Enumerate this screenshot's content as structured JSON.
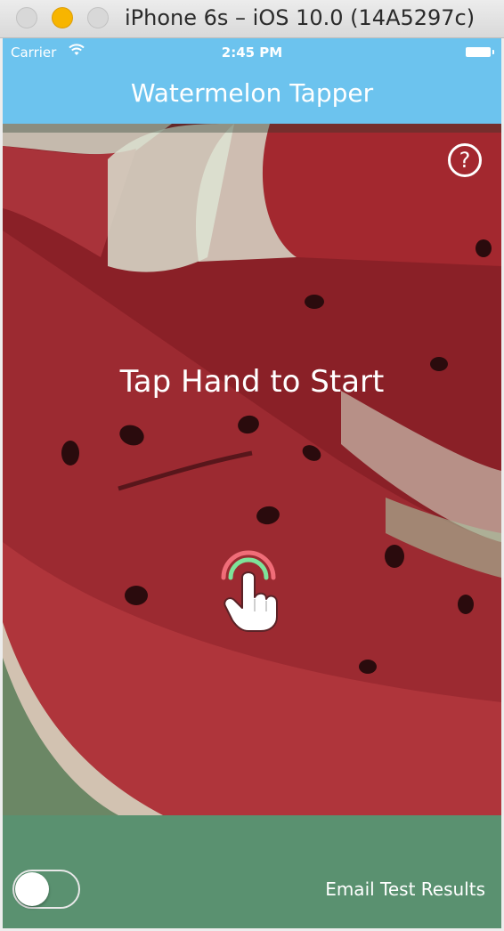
{
  "window": {
    "title": "iPhone 6s – iOS 10.0 (14A5297c)"
  },
  "status_bar": {
    "carrier": "Carrier",
    "time": "2:45 PM"
  },
  "nav": {
    "title": "Watermelon Tapper"
  },
  "main": {
    "help_label": "?",
    "prompt": "Tap Hand to Start"
  },
  "footer": {
    "toggle_on": false,
    "email_label": "Email Test Results"
  },
  "colors": {
    "nav_blue": "#6cc3ee",
    "footer_green": "#5a9170",
    "melon_red": "#8b2128",
    "ring_outer": "#f06d78",
    "ring_inner": "#7ee39a"
  },
  "icons": [
    "wifi-icon",
    "battery-icon",
    "help-icon",
    "tap-hand-icon"
  ]
}
